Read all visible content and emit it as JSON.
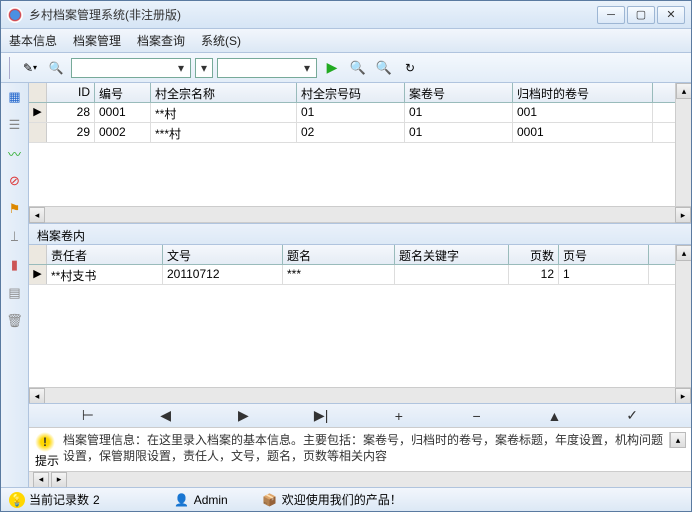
{
  "window": {
    "title": "乡村档案管理系统(非注册版)"
  },
  "menu": {
    "items": [
      "基本信息",
      "档案管理",
      "档案查询",
      "系统(S)"
    ]
  },
  "toolbar": {
    "pencil": "✎",
    "search": "🔍",
    "play": "▶",
    "refresh": "↻"
  },
  "grid1": {
    "columns": [
      "ID",
      "编号",
      "村全宗名称",
      "村全宗号码",
      "案卷号",
      "归档时的卷号"
    ],
    "rows": [
      {
        "id": "28",
        "bh": "0001",
        "name": "**村",
        "code": "01",
        "ajh": "01",
        "gdh": "001",
        "indicator": "▶"
      },
      {
        "id": "29",
        "bh": "0002",
        "name": "***村",
        "code": "02",
        "ajh": "01",
        "gdh": "0001",
        "indicator": ""
      }
    ]
  },
  "section": {
    "title": "档案卷内"
  },
  "grid2": {
    "columns": [
      "责任者",
      "文号",
      "题名",
      "题名关键字",
      "页数",
      "页号"
    ],
    "rows": [
      {
        "zrz": "**村支书",
        "wh": "20110712",
        "tm": "***",
        "tmkw": "",
        "ys": "12",
        "yh": "1",
        "indicator": "▶"
      }
    ]
  },
  "navigator": {
    "first": "⊢",
    "prev": "◀",
    "next": "▶",
    "last": "▶|",
    "add": "+",
    "delete": "−",
    "edit": "▲",
    "confirm": "✓"
  },
  "info": {
    "label": "提示",
    "text": "档案管理信息：在这里录入档案的基本信息。主要包括：案卷号，归档时的卷号，案卷标题，年度设置，机构问题设置，保管期限设置，责任人，文号，题名，页数等相关内容"
  },
  "status": {
    "records_label": "当前记录数",
    "records_value": "2",
    "user": "Admin",
    "welcome": "欢迎使用我们的产品！"
  }
}
